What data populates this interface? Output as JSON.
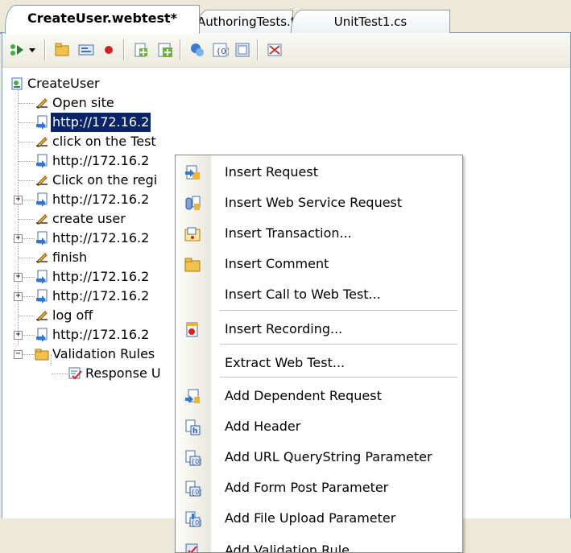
{
  "tabs": [
    {
      "label": "CreateUser.webtest*",
      "active": true
    },
    {
      "label": "AuthoringTests.txt",
      "active": false
    },
    {
      "label": "UnitTest1.cs",
      "active": false
    }
  ],
  "toolbar": {
    "buttons": [
      "run-test-icon",
      "dropdown-arrow-icon",
      "insert-comment-icon",
      "generate-code-icon",
      "record-icon",
      "add-request-plugin-icon",
      "add-webtest-plugin-icon",
      "set-credentials-icon",
      "parameterize-icon",
      "add-datasource-icon",
      "edit-icon"
    ]
  },
  "tree": {
    "root": "CreateUser",
    "items": [
      {
        "label": "Open site",
        "type": "comment"
      },
      {
        "label": "http://172.16.2",
        "type": "request",
        "selected": true
      },
      {
        "label": "click on the Test",
        "type": "comment"
      },
      {
        "label": "http://172.16.2",
        "type": "request"
      },
      {
        "label": "Click on the regi",
        "type": "comment"
      },
      {
        "label": "http://172.16.2",
        "type": "request",
        "expandable": true
      },
      {
        "label": "create user",
        "type": "comment"
      },
      {
        "label": "http://172.16.2",
        "type": "request",
        "expandable": true
      },
      {
        "label": "finish",
        "type": "comment"
      },
      {
        "label": "http://172.16.2",
        "type": "request",
        "expandable": true
      },
      {
        "label": "http://172.16.2",
        "type": "request",
        "expandable": true
      },
      {
        "label": "log off",
        "type": "comment"
      },
      {
        "label": "http://172.16.2",
        "type": "request",
        "expandable": true
      },
      {
        "label": "Validation Rules",
        "type": "folder",
        "expanded": true
      },
      {
        "label": "Response U",
        "type": "rule"
      }
    ]
  },
  "context_menu": {
    "items": [
      {
        "label": "Insert Request",
        "icon": "insert-request-icon"
      },
      {
        "label": "Insert Web Service Request",
        "icon": "insert-web-service-icon"
      },
      {
        "label": "Insert Transaction...",
        "icon": "insert-transaction-icon"
      },
      {
        "label": "Insert Comment",
        "icon": "insert-comment-icon"
      },
      {
        "label": "Insert Call to Web Test...",
        "icon": ""
      },
      {
        "label": "Insert Recording...",
        "icon": "insert-recording-icon"
      },
      {
        "label": "Extract Web Test...",
        "icon": ""
      },
      {
        "label": "Add Dependent Request",
        "icon": "add-dependent-request-icon"
      },
      {
        "label": "Add Header",
        "icon": "add-header-icon"
      },
      {
        "label": "Add URL QueryString Parameter",
        "icon": "add-querystring-icon"
      },
      {
        "label": "Add Form Post Parameter",
        "icon": "add-form-post-icon"
      },
      {
        "label": "Add File Upload Parameter",
        "icon": "add-file-upload-icon"
      },
      {
        "label": "Add Validation Rule",
        "icon": "add-validation-rule-icon"
      }
    ]
  },
  "colors": {
    "selection": "#0a246a",
    "tab_border": "#7f9db9",
    "chrome": "#ece9d8"
  }
}
